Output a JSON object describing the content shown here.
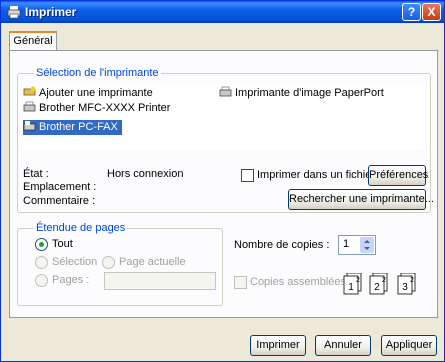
{
  "window": {
    "title": "Imprimer",
    "help_btn": "?",
    "close_btn": "X"
  },
  "tabs": [
    {
      "label": "Général"
    }
  ],
  "printer_selection": {
    "group_title": "Sélection de l'imprimante",
    "printers": [
      {
        "name": "Ajouter une imprimante",
        "icon": "add-printer-icon"
      },
      {
        "name": "Brother MFC-XXXX  Printer",
        "icon": "printer-icon"
      },
      {
        "name": "Brother PC-FAX",
        "icon": "fax-icon",
        "selected": true
      },
      {
        "name": "Imprimante d'image PaperPort",
        "icon": "paperport-printer-icon"
      }
    ],
    "status_label": "État :",
    "status_value": "Hors connexion",
    "location_label": "Emplacement :",
    "comment_label": "Commentaire :",
    "print_to_file_label": "Imprimer dans un fichier",
    "preferences_button": "Préférences",
    "find_printer_button": "Rechercher une imprimante..."
  },
  "page_range": {
    "group_title": "Étendue de pages",
    "all_label": "Tout",
    "selection_label": "Sélection",
    "current_page_label": "Page actuelle",
    "pages_label": "Pages :",
    "pages_value": ""
  },
  "copies": {
    "count_label": "Nombre de copies :",
    "count_value": "1",
    "collate_label": "Copies assemblées"
  },
  "footer": {
    "print_button": "Imprimer",
    "cancel_button": "Annuler",
    "apply_button": "Appliquer"
  },
  "colors": {
    "title_bar": "#0a5ee8",
    "group_title": "#0046d5",
    "selection": "#316ac5"
  }
}
